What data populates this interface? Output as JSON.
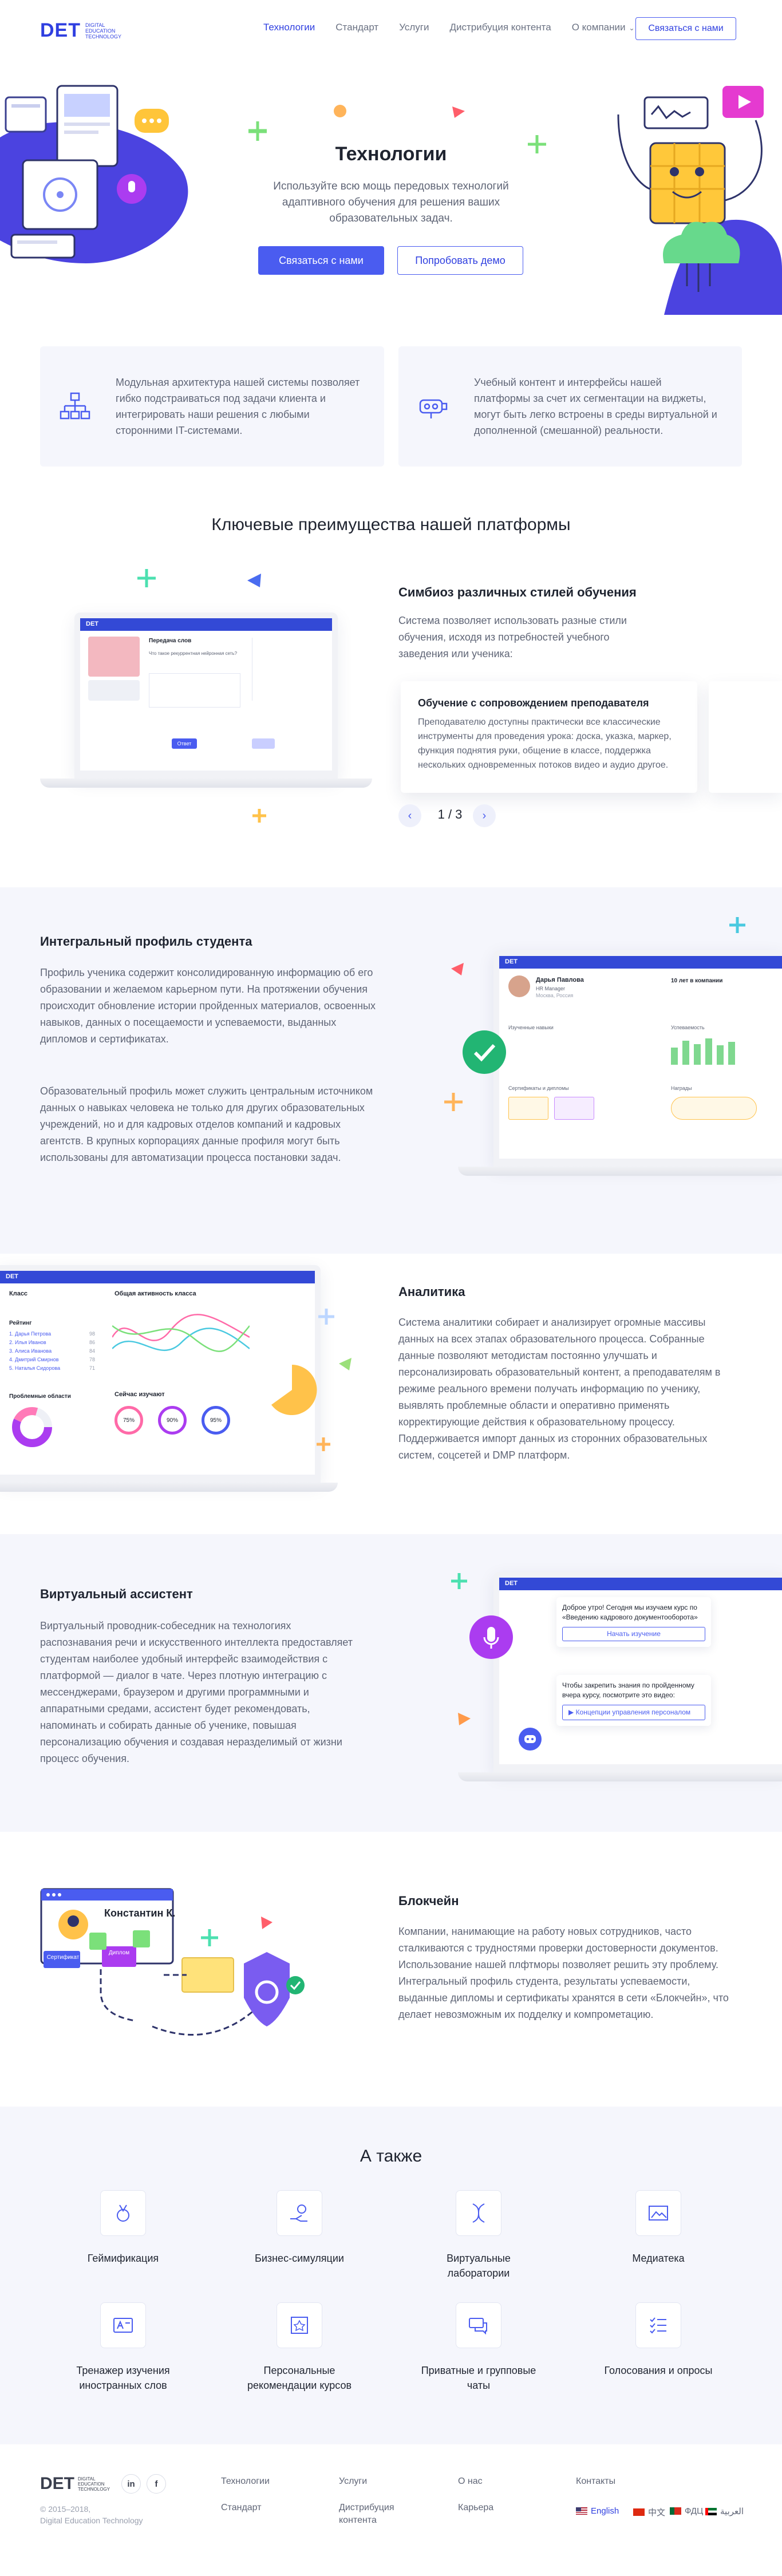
{
  "brand": {
    "logo": "DET",
    "tagline": "Digital Education Technology",
    "accent": "#4a5cf0"
  },
  "nav": {
    "items": [
      "Технологии",
      "Стандарт",
      "Услуги",
      "Дистрибуция контента",
      "О компании"
    ],
    "contact_button": "Связаться с нами"
  },
  "hero": {
    "title": "Технологии",
    "text": "Используйте всю мощь передовых технологий адаптивного обучения для решения ваших образовательных задач.",
    "primary_button": "Связаться с нами",
    "secondary_button": "Попробовать демо"
  },
  "features": [
    {
      "icon": "modules-icon",
      "text": "Модульная архитектура нашей системы позволяет гибко подстраиваться под задачи клиента и интегрировать наши решения с любыми сторонними IT-системами."
    },
    {
      "icon": "vr-headset-icon",
      "text": "Учебный контент и интерфейсы нашей платформы за счет их сегментации на виджеты, могут быть легко встроены в среды виртуальной и дополненной (смешанной) реальности."
    }
  ],
  "advantages": {
    "title": "Ключевые преимущества нашей платформы",
    "heading": "Симбиоз различных стилей обучения",
    "text": "Система позволяет использовать разные стили обучения, исходя из потребностей учебного заведения или ученика:",
    "card_title": "Обучение с сопровождением преподавателя",
    "card_text": "Преподавателю доступны практически все классические инструменты для проведения урока: доска, указка, маркер, функция поднятия руки, общение в классе, поддержка нескольких одновременных потоков видео и аудио другое.",
    "pager": "1 / 3",
    "mock": {
      "appbar": "DET",
      "task": "Передача слов",
      "reply_button": "Ответ",
      "question": "Что такое рекуррентная нейронная сеть?"
    }
  },
  "profile": {
    "heading": "Интегральный профиль студента",
    "text1": "Профиль ученика содержит консолидированную информацию об его образовании и желаемом карьерном пути. На протяжении обучения происходит обновление истории пройденных материалов, освоенных навыков, данных о посещаемости и успеваемости, выданных дипломов и сертификатах.",
    "text2": "Образовательный профиль может служить центральным источником данных о навыках человека не только для других образовательных учреждений, но и для кадровых отделов компаний и кадровых агентств. В крупных корпорациях данные профиля могут быть использованы для автоматизации процесса постановки задач.",
    "mock": {
      "appbar": "DET",
      "name": "Дарья Павлова",
      "role": "HR Manager",
      "city": "Москва, Россия",
      "stat": "10 лет в компании",
      "col1": "Изученные навыки",
      "col2": "Успеваемость",
      "col3": "Сертификаты и дипломы",
      "col4": "Награды"
    }
  },
  "analytics": {
    "heading": "Аналитика",
    "text": "Система аналитики собирает и анализирует огромные массивы данных на всех этапах образовательного процесса. Собранные данные позволяют методистам постоянно улучшать и персонализировать образовательный контент, а преподавателям в режиме реального времени получать информацию по ученику, выявлять проблемные области и оперативно применять корректирующие действия к образовательному процессу. Поддерживается импорт данных из сторонних образовательных систем, соцсетей и DMP платформ.",
    "mock": {
      "appbar": "DET",
      "card1": "Класс",
      "card2": "Общая активность класса",
      "card3": "Рейтинг",
      "card4": "Проблемные области",
      "card5": "Сейчас изучают",
      "students": [
        "1. Дарья Петрова",
        "2. Илья Иванов",
        "3. Алиса Иванова",
        "4. Дмитрий Смирнов",
        "5. Наталья Сидорова"
      ],
      "scores": [
        "98",
        "86",
        "84",
        "78",
        "71"
      ],
      "rings": [
        "75%",
        "90%",
        "95%"
      ]
    }
  },
  "assistant": {
    "heading": "Виртуальный ассистент",
    "text": "Виртуальный проводник-собеседник на технологиях распознавания речи и искусственного интеллекта предоставляет студентам наиболее удобный интерфейс взаимодействия с платформой — диалог в чате. Через плотную интеграцию с мессенджерами, браузером и другими программными и аппаратными средами, ассистент будет рекомендовать, напоминать и собирать данные об ученике, повышая персонализацию обучения и создавая неразделимый от жизни процесс обучения.",
    "mock": {
      "appbar": "DET",
      "msg1": "Доброе утро! Сегодня мы изучаем курс по «Введению кадрового документооборота»",
      "btn1": "Начать изучение",
      "msg2": "Чтобы закрепить знания по пройденному вчера курсу, посмотрите это видео:",
      "btn2": "Концепции управления персоналом"
    }
  },
  "blockchain": {
    "heading": "Блокчейн",
    "text": "Компании, нанимающие на работу новых сотрудников, часто сталкиваются с трудностями проверки достоверности документов. Использование нашей плфтморы позволяет решить эту проблему. Интегральный профиль студента, результаты успеваемости, выданные дипломы и сертификаты хранятся в сети «Блокчейн», что делает невозможным их подделку и компрометацию.",
    "mock": {
      "person": "Константин К.",
      "cert": "Сертификат",
      "diploma": "Диплом"
    }
  },
  "also": {
    "title": "А также",
    "items": [
      {
        "icon": "medal-icon",
        "label": "Геймификация"
      },
      {
        "icon": "hand-coin-icon",
        "label": "Бизнес-симуляции"
      },
      {
        "icon": "dna-icon",
        "label": "Виртуальные лаборатории"
      },
      {
        "icon": "media-icon",
        "label": "Медиатека"
      },
      {
        "icon": "translate-card-icon",
        "label": "Тренажер изучения иностранных слов"
      },
      {
        "icon": "personal-badge-icon",
        "label": "Персональные рекомендации курсов"
      },
      {
        "icon": "chat-icon",
        "label": "Приватные и групповые чаты"
      },
      {
        "icon": "checklist-icon",
        "label": "Голосования и опросы"
      }
    ]
  },
  "footer": {
    "copyright": "© 2015–2018,",
    "company": "Digital Education Technology",
    "social": [
      "in",
      "f"
    ],
    "col1": [
      "Технологии",
      "Стандарт"
    ],
    "col2": [
      "Услуги",
      "Дистрибуция контента"
    ],
    "col3": [
      "О нас",
      "Карьера"
    ],
    "col4_title": "Контакты",
    "languages": [
      "English",
      "中文",
      "ФДЦ",
      "العربية"
    ]
  }
}
